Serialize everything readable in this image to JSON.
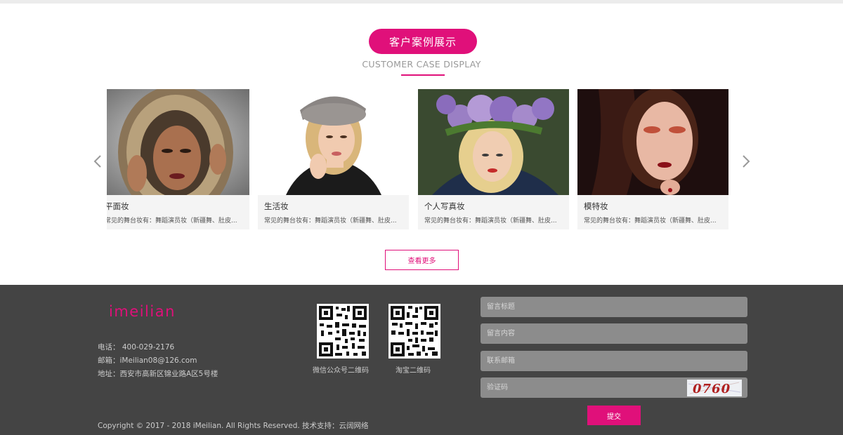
{
  "section": {
    "title": "客户案例展示",
    "subtitle": "CUSTOMER CASE DISPLAY"
  },
  "carousel": {
    "prev_icon": "chevron-left-icon",
    "next_icon": "chevron-right-icon",
    "cards": [
      {
        "title": "平面妆",
        "desc": "常见的舞台妆有：舞蹈演员妆（新疆舞、肚皮..."
      },
      {
        "title": "生活妆",
        "desc": "常见的舞台妆有：舞蹈演员妆（新疆舞、肚皮..."
      },
      {
        "title": "个人写真妆",
        "desc": "常见的舞台妆有：舞蹈演员妆（新疆舞、肚皮..."
      },
      {
        "title": "模特妆",
        "desc": "常见的舞台妆有：舞蹈演员妆（新疆舞、肚皮..."
      }
    ]
  },
  "more_button": "查看更多",
  "footer": {
    "logo": "imeilian",
    "phone": "电话： 400-029-2176",
    "email": "邮箱：iMeilian08@126.com",
    "address": "地址：西安市高新区锦业路A区5号楼",
    "qr_wechat_label": "微信公众号二维码",
    "qr_taobao_label": "淘宝二维码",
    "copyright": "Copyright © 2017 - 2018 iMeilian. All Rights Reserved.   技术支持：云阔网络",
    "form": {
      "title_placeholder": "留言标题",
      "content_placeholder": "留言内容",
      "email_placeholder": "联系邮箱",
      "captcha_placeholder": "验证码",
      "captcha_code": "0760",
      "submit_label": "提交"
    }
  },
  "colors": {
    "accent": "#e0107a",
    "footer_bg": "#444444",
    "field_bg": "#8c8c8c"
  }
}
